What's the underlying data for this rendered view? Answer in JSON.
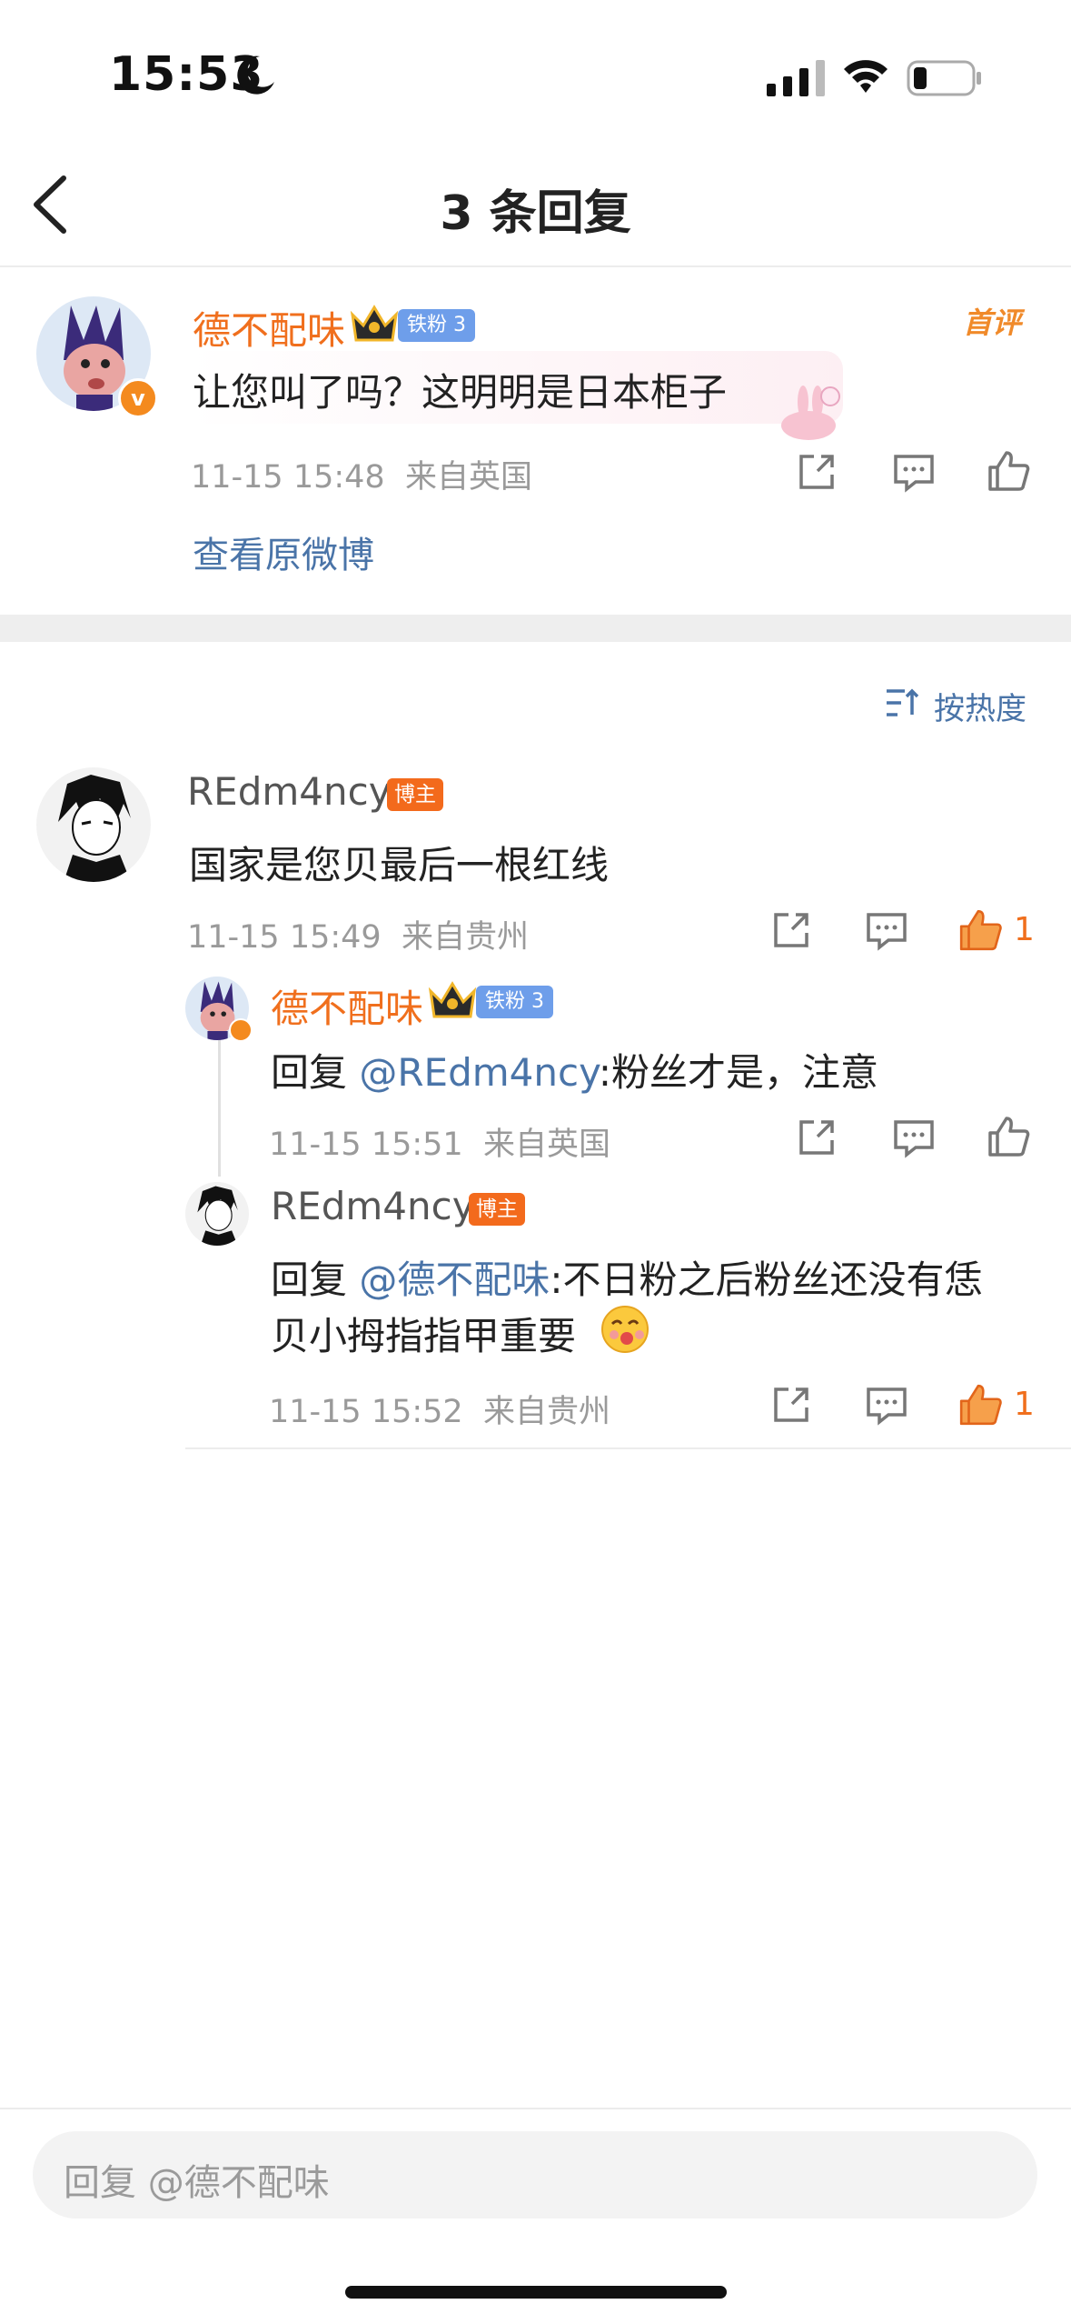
{
  "status_bar": {
    "time": "15:53"
  },
  "header": {
    "title": "3 条回复",
    "back_icon": "chevron-left-icon"
  },
  "root_comment": {
    "user": "德不配味",
    "fan_badge": "铁粉 3",
    "first_comment_tag": "首评",
    "text": "让您叫了吗？这明明是日本柜子",
    "time": "11-15 15:48",
    "location": "来自英国",
    "view_original": "查看原微博"
  },
  "sort": {
    "label": "按热度"
  },
  "main_comment": {
    "user": "REdm4ncy",
    "badge": "博主",
    "text": "国家是您贝最后一根红线",
    "time": "11-15 15:49",
    "location": "来自贵州",
    "likes": "1"
  },
  "replies": [
    {
      "user": "德不配味",
      "fan_badge": "铁粉 3",
      "prefix": "回复 ",
      "mention": "@REdm4ncy",
      "text": ":粉丝才是，注意",
      "time": "11-15 15:51",
      "location": "来自英国"
    },
    {
      "user": "REdm4ncy",
      "badge": "博主",
      "prefix": "回复 ",
      "mention": "@德不配味",
      "text_line1": ":不日粉之后粉丝还没有恁",
      "text_line2": "贝小拇指指甲重要",
      "time": "11-15 15:52",
      "location": "来自贵州",
      "likes": "1"
    }
  ],
  "reply_input": {
    "placeholder": "回复 @德不配味"
  },
  "colors": {
    "accent_orange": "#f06f1d",
    "link_blue": "#4a74a8",
    "fan_badge_blue": "#6e9eea"
  }
}
